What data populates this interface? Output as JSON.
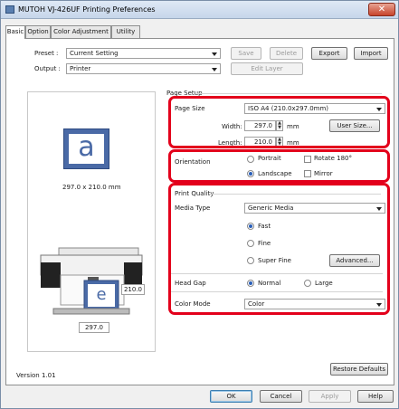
{
  "window": {
    "title": "MUTOH VJ-426UF Printing Preferences",
    "close_glyph": "✕"
  },
  "tabs": [
    {
      "label": "Basic"
    },
    {
      "label": "Option"
    },
    {
      "label": "Color Adjustment"
    },
    {
      "label": "Utility"
    }
  ],
  "preset": {
    "label": "Preset :",
    "value": "Current Setting"
  },
  "output": {
    "label": "Output :",
    "value": "Printer"
  },
  "buttons": {
    "save": "Save",
    "delete": "Delete",
    "export": "Export",
    "import": "Import",
    "edit_layer": "Edit Layer",
    "user_size": "User Size...",
    "advanced": "Advanced...",
    "restore_defaults": "Restore Defaults",
    "ok": "OK",
    "cancel": "Cancel",
    "apply": "Apply",
    "help": "Help"
  },
  "preview": {
    "glyph": "a",
    "size_text": "297.0 x 210.0 mm",
    "printer_glyph": "e",
    "side_value": "210.0",
    "bottom_value": "297.0"
  },
  "page_setup": {
    "heading": "Page Setup",
    "page_size_label": "Page Size",
    "page_size_value": "ISO A4 (210.0x297.0mm)",
    "width_label": "Width:",
    "width_value": "297.0",
    "width_unit": "mm",
    "length_label": "Length:",
    "length_value": "210.0",
    "length_unit": "mm"
  },
  "orientation": {
    "label": "Orientation",
    "portrait": "Portrait",
    "landscape": "Landscape",
    "rotate": "Rotate 180°",
    "mirror": "Mirror",
    "selected": "Landscape"
  },
  "print_quality": {
    "heading": "Print Quality",
    "media_type_label": "Media Type",
    "media_type_value": "Generic Media",
    "fast": "Fast",
    "fine": "Fine",
    "super_fine": "Super Fine",
    "selected": "Fast"
  },
  "head_gap": {
    "label": "Head Gap",
    "normal": "Normal",
    "large": "Large",
    "selected": "Normal"
  },
  "color_mode": {
    "label": "Color Mode",
    "value": "Color"
  },
  "version": "Version 1.01",
  "colors": {
    "highlight": "#e3001b",
    "accent": "#2a5fb8"
  }
}
